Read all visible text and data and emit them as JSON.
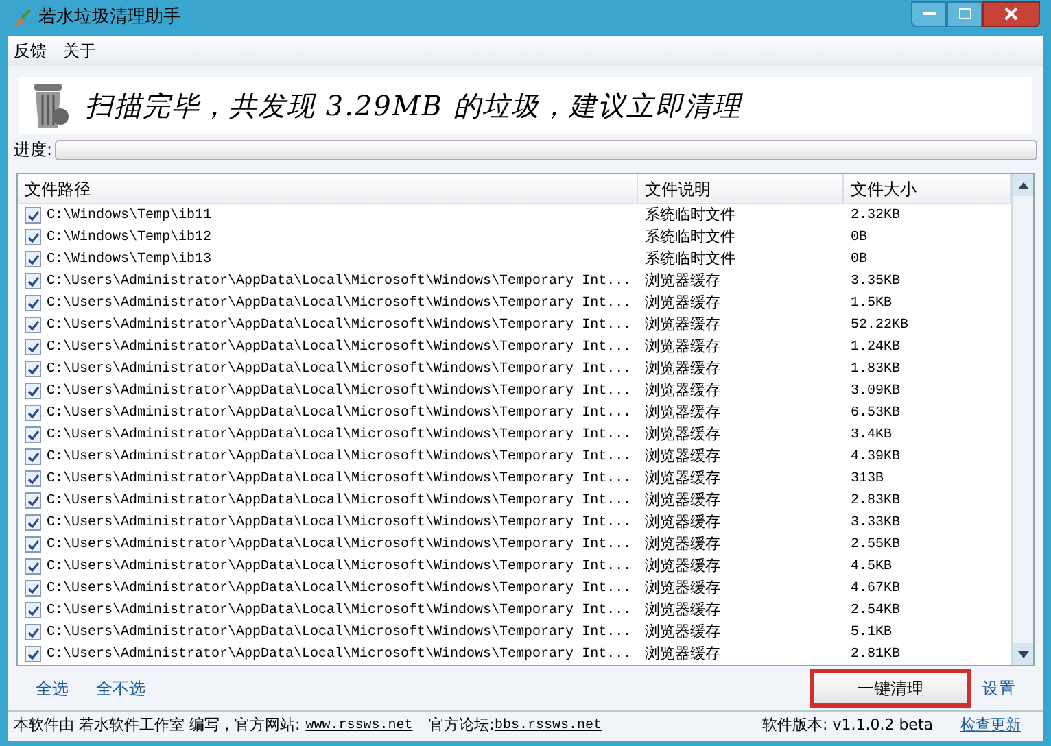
{
  "window": {
    "title": "若水垃圾清理助手"
  },
  "menu": [
    "反馈",
    "关于"
  ],
  "banner": {
    "message": "扫描完毕，共发现 3.29MB 的垃圾，建议立即清理"
  },
  "progress": {
    "label": "进度:",
    "level": 0
  },
  "table": {
    "columns": [
      "文件路径",
      "文件说明",
      "文件大小"
    ],
    "rows": [
      {
        "checked": true,
        "path": "C:\\Windows\\Temp\\ib11",
        "desc": "系统临时文件",
        "size": "2.32KB"
      },
      {
        "checked": true,
        "path": "C:\\Windows\\Temp\\ib12",
        "desc": "系统临时文件",
        "size": "0B"
      },
      {
        "checked": true,
        "path": "C:\\Windows\\Temp\\ib13",
        "desc": "系统临时文件",
        "size": "0B"
      },
      {
        "checked": true,
        "path": "C:\\Users\\Administrator\\AppData\\Local\\Microsoft\\Windows\\Temporary Int...",
        "desc": "浏览器缓存",
        "size": "3.35KB"
      },
      {
        "checked": true,
        "path": "C:\\Users\\Administrator\\AppData\\Local\\Microsoft\\Windows\\Temporary Int...",
        "desc": "浏览器缓存",
        "size": "1.5KB"
      },
      {
        "checked": true,
        "path": "C:\\Users\\Administrator\\AppData\\Local\\Microsoft\\Windows\\Temporary Int...",
        "desc": "浏览器缓存",
        "size": "52.22KB"
      },
      {
        "checked": true,
        "path": "C:\\Users\\Administrator\\AppData\\Local\\Microsoft\\Windows\\Temporary Int...",
        "desc": "浏览器缓存",
        "size": "1.24KB"
      },
      {
        "checked": true,
        "path": "C:\\Users\\Administrator\\AppData\\Local\\Microsoft\\Windows\\Temporary Int...",
        "desc": "浏览器缓存",
        "size": "1.83KB"
      },
      {
        "checked": true,
        "path": "C:\\Users\\Administrator\\AppData\\Local\\Microsoft\\Windows\\Temporary Int...",
        "desc": "浏览器缓存",
        "size": "3.09KB"
      },
      {
        "checked": true,
        "path": "C:\\Users\\Administrator\\AppData\\Local\\Microsoft\\Windows\\Temporary Int...",
        "desc": "浏览器缓存",
        "size": "6.53KB"
      },
      {
        "checked": true,
        "path": "C:\\Users\\Administrator\\AppData\\Local\\Microsoft\\Windows\\Temporary Int...",
        "desc": "浏览器缓存",
        "size": "3.4KB"
      },
      {
        "checked": true,
        "path": "C:\\Users\\Administrator\\AppData\\Local\\Microsoft\\Windows\\Temporary Int...",
        "desc": "浏览器缓存",
        "size": "4.39KB"
      },
      {
        "checked": true,
        "path": "C:\\Users\\Administrator\\AppData\\Local\\Microsoft\\Windows\\Temporary Int...",
        "desc": "浏览器缓存",
        "size": "313B"
      },
      {
        "checked": true,
        "path": "C:\\Users\\Administrator\\AppData\\Local\\Microsoft\\Windows\\Temporary Int...",
        "desc": "浏览器缓存",
        "size": "2.83KB"
      },
      {
        "checked": true,
        "path": "C:\\Users\\Administrator\\AppData\\Local\\Microsoft\\Windows\\Temporary Int...",
        "desc": "浏览器缓存",
        "size": "3.33KB"
      },
      {
        "checked": true,
        "path": "C:\\Users\\Administrator\\AppData\\Local\\Microsoft\\Windows\\Temporary Int...",
        "desc": "浏览器缓存",
        "size": "2.55KB"
      },
      {
        "checked": true,
        "path": "C:\\Users\\Administrator\\AppData\\Local\\Microsoft\\Windows\\Temporary Int...",
        "desc": "浏览器缓存",
        "size": "4.5KB"
      },
      {
        "checked": true,
        "path": "C:\\Users\\Administrator\\AppData\\Local\\Microsoft\\Windows\\Temporary Int...",
        "desc": "浏览器缓存",
        "size": "4.67KB"
      },
      {
        "checked": true,
        "path": "C:\\Users\\Administrator\\AppData\\Local\\Microsoft\\Windows\\Temporary Int...",
        "desc": "浏览器缓存",
        "size": "2.54KB"
      },
      {
        "checked": true,
        "path": "C:\\Users\\Administrator\\AppData\\Local\\Microsoft\\Windows\\Temporary Int...",
        "desc": "浏览器缓存",
        "size": "5.1KB"
      },
      {
        "checked": true,
        "path": "C:\\Users\\Administrator\\AppData\\Local\\Microsoft\\Windows\\Temporary Int...",
        "desc": "浏览器缓存",
        "size": "2.81KB"
      }
    ]
  },
  "selection_links": [
    "全选",
    "全不选"
  ],
  "clean_button": {
    "label": "一键清理",
    "highlighted": true
  },
  "settings_link": "设置",
  "status_bar": {
    "author_label": "本软件由 若水软件工作室 编写，官方网站:",
    "website": "www.rssws.net",
    "forum_label": "官方论坛:",
    "forum": "bbs.rssws.net",
    "version": "软件版本: v1.1.0.2 beta",
    "update_link": "检查更新"
  }
}
